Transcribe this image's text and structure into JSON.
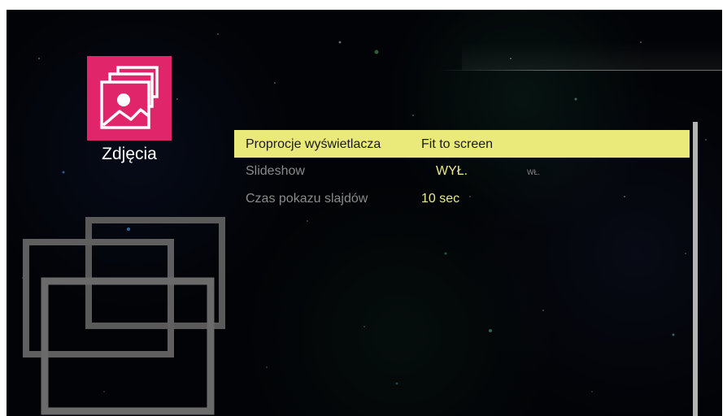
{
  "app": {
    "title": "Zdjęcia",
    "icon": "photos-icon",
    "tile_color": "#e0256a"
  },
  "settings": [
    {
      "label": "Proprocje wyświetlacza",
      "value": "Fit to screen",
      "alt": "",
      "selected": true
    },
    {
      "label": "Slideshow",
      "value": "WYŁ.",
      "alt": "WŁ.",
      "selected": false
    },
    {
      "label": "Czas pokazu slajdów",
      "value": "10 sec",
      "alt": "",
      "selected": false
    }
  ],
  "colors": {
    "highlight": "#e9ea7a",
    "value_text": "#eaea8a",
    "label_text": "#8a8a8a",
    "background": "#020306"
  }
}
